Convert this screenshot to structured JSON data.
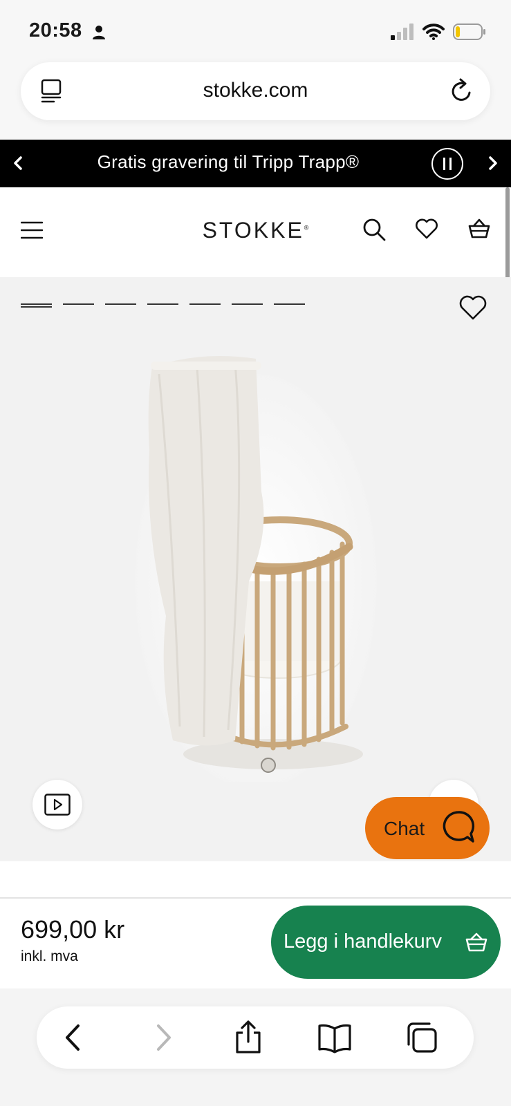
{
  "status_bar": {
    "time": "20:58",
    "icons": [
      "person-icon",
      "signal-icon",
      "wifi-icon",
      "battery-icon"
    ]
  },
  "browser": {
    "url": "stokke.com",
    "icons": [
      "reader-icon",
      "reload-icon"
    ]
  },
  "promo_banner": {
    "text": "Gratis gravering til Tripp Trapp®",
    "icons": [
      "chevron-left-icon",
      "pause-icon",
      "chevron-right-icon"
    ]
  },
  "header": {
    "logo": "STOKKE",
    "logo_mark": "®",
    "icons": [
      "menu-icon",
      "search-icon",
      "heart-icon",
      "basket-icon"
    ]
  },
  "gallery": {
    "image_count": 7,
    "active_index": 0,
    "image_subject": "crib-with-canopy",
    "icons": [
      "heart-icon",
      "play-video-icon"
    ]
  },
  "chat": {
    "label": "Chat",
    "color": "#e9730f"
  },
  "purchase": {
    "price": "699,00 kr",
    "price_note": "inkl. mva",
    "add_to_cart_label": "Legg i handlekurv",
    "button_color": "#17824f"
  },
  "safari_toolbar": {
    "icons": [
      "back-icon",
      "forward-icon",
      "share-icon",
      "bookmarks-icon",
      "tabs-icon"
    ]
  }
}
